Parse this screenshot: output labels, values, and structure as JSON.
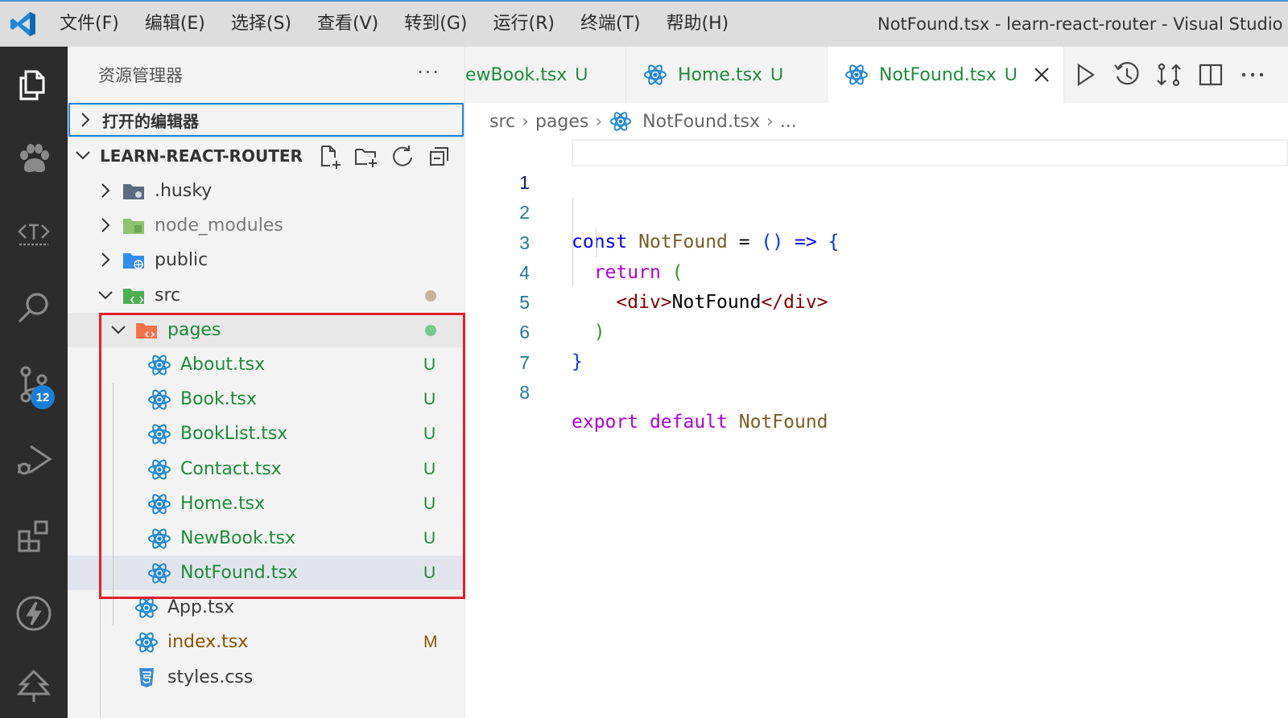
{
  "window": {
    "title": "NotFound.tsx - learn-react-router - Visual Studio Code"
  },
  "menu": [
    "文件(F)",
    "编辑(E)",
    "选择(S)",
    "查看(V)",
    "转到(G)",
    "运行(R)",
    "终端(T)",
    "帮助(H)"
  ],
  "activity_bar": {
    "items": [
      "explorer-icon",
      "paw-icon",
      "template-icon",
      "search-icon",
      "source-control-icon",
      "run-debug-icon",
      "extensions-icon",
      "lightning-icon",
      "tree-icon"
    ],
    "scm_badge": "12"
  },
  "sidebar": {
    "title": "资源管理器",
    "more": "···",
    "open_editors": "打开的编辑器",
    "project": "LEARN-REACT-ROUTER",
    "tree": [
      {
        "name": ".husky",
        "type": "folder",
        "icon": "folder-husky-icon",
        "depth": 1,
        "expanded": false
      },
      {
        "name": "node_modules",
        "type": "folder",
        "icon": "folder-node-icon",
        "depth": 1,
        "expanded": false
      },
      {
        "name": "public",
        "type": "folder",
        "icon": "folder-public-icon",
        "depth": 1,
        "expanded": false
      },
      {
        "name": "src",
        "type": "folder",
        "icon": "folder-src-icon",
        "depth": 1,
        "expanded": true,
        "dot": "#c8b497"
      },
      {
        "name": "pages",
        "type": "folder",
        "icon": "folder-pages-icon",
        "depth": 2,
        "expanded": true,
        "dot": "#73c991"
      },
      {
        "name": "About.tsx",
        "type": "file",
        "icon": "react-icon",
        "depth": 3,
        "status": "U"
      },
      {
        "name": "Book.tsx",
        "type": "file",
        "icon": "react-icon",
        "depth": 3,
        "status": "U"
      },
      {
        "name": "BookList.tsx",
        "type": "file",
        "icon": "react-icon",
        "depth": 3,
        "status": "U"
      },
      {
        "name": "Contact.tsx",
        "type": "file",
        "icon": "react-icon",
        "depth": 3,
        "status": "U"
      },
      {
        "name": "Home.tsx",
        "type": "file",
        "icon": "react-icon",
        "depth": 3,
        "status": "U"
      },
      {
        "name": "NewBook.tsx",
        "type": "file",
        "icon": "react-icon",
        "depth": 3,
        "status": "U"
      },
      {
        "name": "NotFound.tsx",
        "type": "file",
        "icon": "react-icon",
        "depth": 3,
        "status": "U",
        "selected": true
      },
      {
        "name": "App.tsx",
        "type": "file",
        "icon": "react-icon",
        "depth": 2,
        "status": ""
      },
      {
        "name": "index.tsx",
        "type": "file",
        "icon": "react-icon",
        "depth": 2,
        "status": "M"
      },
      {
        "name": "styles.css",
        "type": "file",
        "icon": "css-icon",
        "depth": 2,
        "status": ""
      }
    ]
  },
  "tabs": [
    {
      "name": "ewBook.tsx",
      "status": "U",
      "active": false
    },
    {
      "name": "Home.tsx",
      "status": "U",
      "active": false
    },
    {
      "name": "NotFound.tsx",
      "status": "U",
      "active": true
    }
  ],
  "breadcrumb": [
    "src",
    "pages",
    "NotFound.tsx",
    "..."
  ],
  "code": {
    "line_numbers": [
      "1",
      "2",
      "3",
      "4",
      "5",
      "6",
      "7",
      "8"
    ],
    "current_line": "1"
  },
  "colors": {
    "git_untracked": "#1f8a3a",
    "git_modified": "#895503",
    "accent": "#1f7fd6",
    "highlight_box": "#e0202a"
  }
}
